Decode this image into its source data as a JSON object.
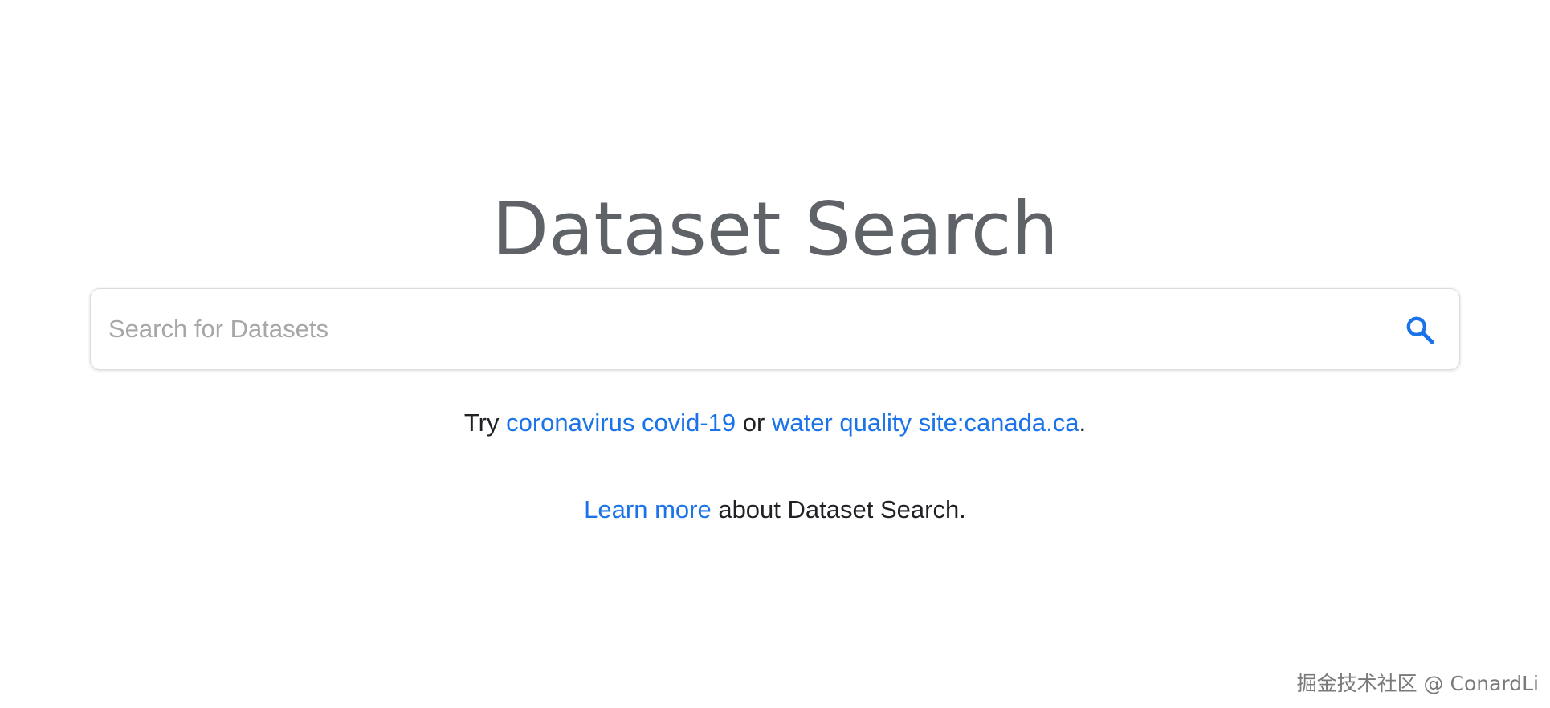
{
  "header": {
    "title": "Dataset Search"
  },
  "search": {
    "placeholder": "Search for Datasets",
    "value": "",
    "button_icon": "search-icon",
    "accent_color": "#1a73e8"
  },
  "suggestions": {
    "prefix": "Try",
    "link_1": "coronavirus covid-19",
    "middle": "or",
    "link_2": "water quality site:canada.ca",
    "suffix": "."
  },
  "learn": {
    "link": "Learn more",
    "text": "about Dataset Search."
  },
  "watermark": {
    "text": "掘金技术社区 @ ConardLi"
  }
}
